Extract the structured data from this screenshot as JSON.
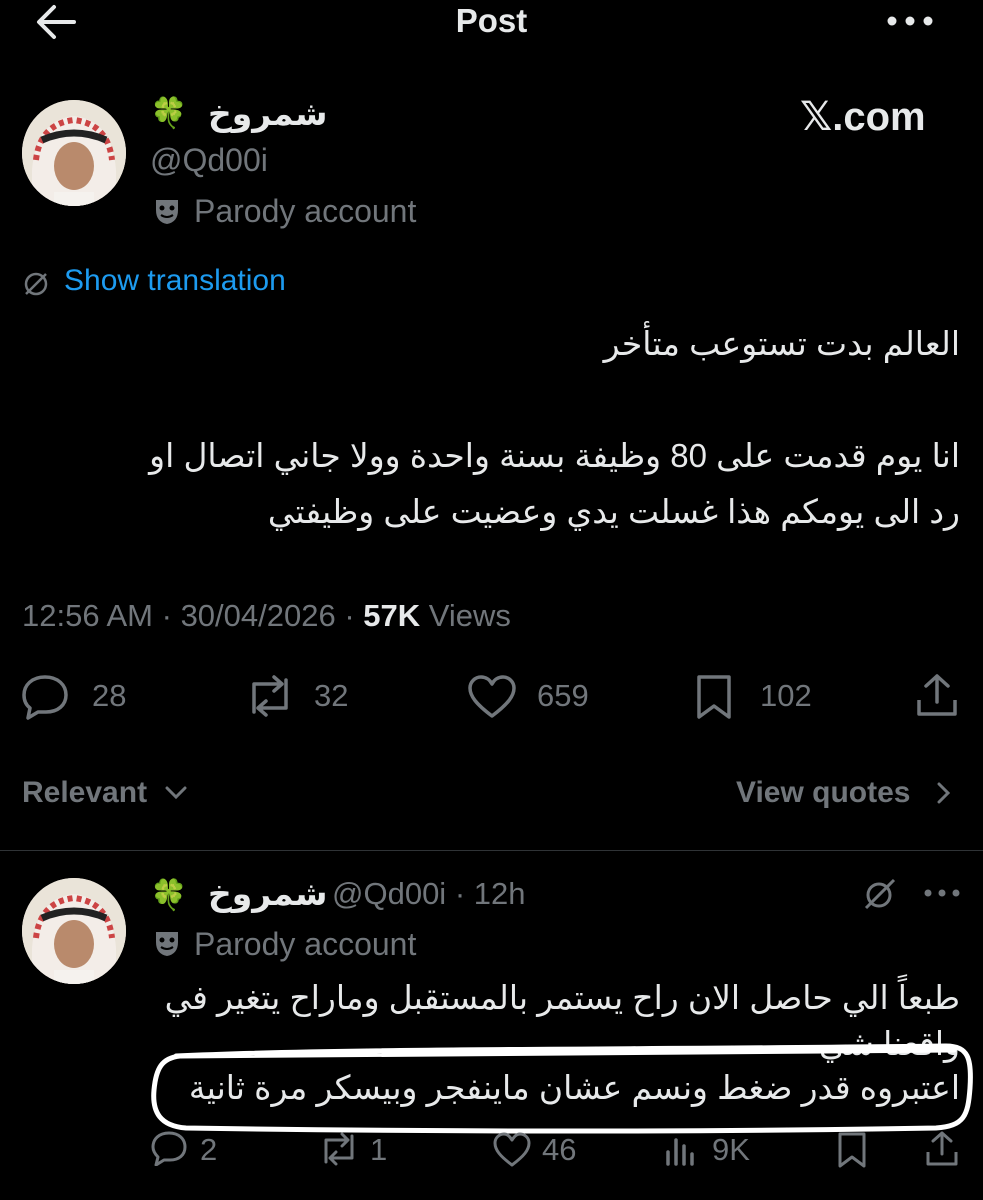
{
  "header": {
    "title": "Post"
  },
  "author": {
    "display_name": "شمروخ",
    "emoji": "🍀",
    "handle": "@Qd00i",
    "parody_label": "Parody account"
  },
  "watermark": "𝕏.com",
  "translation": {
    "label": "Show translation"
  },
  "tweet": {
    "lines": [
      "العالم بدت تستوعب متأخر",
      "انا يوم قدمت على 80 وظيفة بسنة واحدة وولا جاني اتصال او",
      "رد الى يومكم هذا غسلت يدي وعضيت على وظيفتي"
    ],
    "time": "12:56 AM",
    "date": "30/04/2026",
    "views_count": "57K",
    "views_label": "Views",
    "dot": "·"
  },
  "actions": {
    "replies": "28",
    "reposts": "32",
    "likes": "659",
    "bookmarks": "102"
  },
  "sort": {
    "label": "Relevant",
    "quotes_label": "View quotes"
  },
  "reply": {
    "display_name": "شمروخ",
    "emoji": "🍀",
    "handle": "@Qd00i",
    "time": "12h",
    "dot": "·",
    "parody_label": "Parody account",
    "lines": [
      "طبعاً الي حاصل الان راح يستمر بالمستقبل وماراح يتغير في",
      "واقعنا شي",
      "اعتبروه قدر ضغط ونسم عشان ماينفجر وبيسكر مرة ثانية"
    ],
    "replies": "2",
    "reposts": "1",
    "likes": "46",
    "views": "9K"
  },
  "colors": {
    "background": "#000000",
    "text": "#e7e9ea",
    "muted": "#71767b",
    "link": "#1d9bf0",
    "separator": "#2f3336",
    "annotation": "#ffffff"
  }
}
